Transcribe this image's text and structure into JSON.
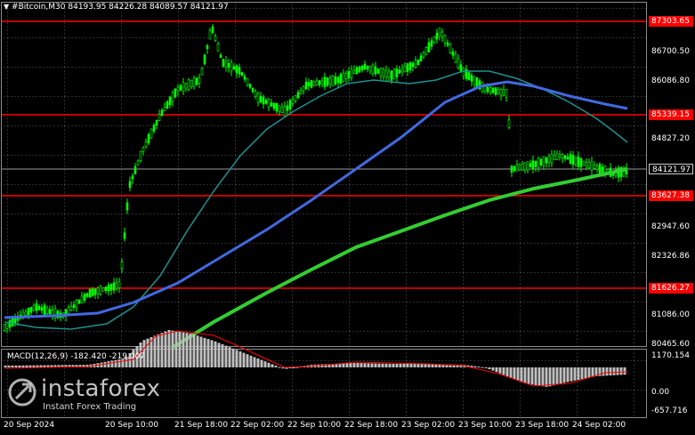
{
  "header": {
    "dropdown_icon": "triangle-down-icon",
    "symbol_line": "#Bitcoin,M30  84193.95 84226.28 84089.57 84121.97"
  },
  "price_axis": {
    "labels": [
      "86700.50",
      "86086.80",
      "84827.20",
      "82947.60",
      "82326.86",
      "81086.00",
      "80465.60"
    ],
    "levels": [
      "87303.65",
      "85339.15",
      "83627.38",
      "81626.27"
    ],
    "current_price": "84121.97",
    "level_color": "#ff0000"
  },
  "macd": {
    "label": "MACD(12,26,9) -182.420 -219.007",
    "axis_labels": [
      "1170.154",
      "0.00",
      "-657.716"
    ]
  },
  "time_axis": {
    "labels": [
      "20 Sep 2024",
      "20 Sep 10:00",
      "21 Sep 18:00",
      "22 Sep 02:00",
      "22 Sep 10:00",
      "22 Sep 18:00",
      "23 Sep 02:00",
      "23 Sep 10:00",
      "23 Sep 18:00",
      "24 Sep 02:00"
    ]
  },
  "watermark": {
    "brand": "instaforex",
    "tagline": "Instant Forex Trading",
    "logo_icon": "instaforex-logo-icon"
  },
  "colors": {
    "candles": "#00ff00",
    "ma_fast": "#1e9090",
    "ma_mid": "#4169e1",
    "ma_slow": "#32cd32",
    "histogram": "#c0c0c0",
    "signal": "#ff0000"
  }
}
